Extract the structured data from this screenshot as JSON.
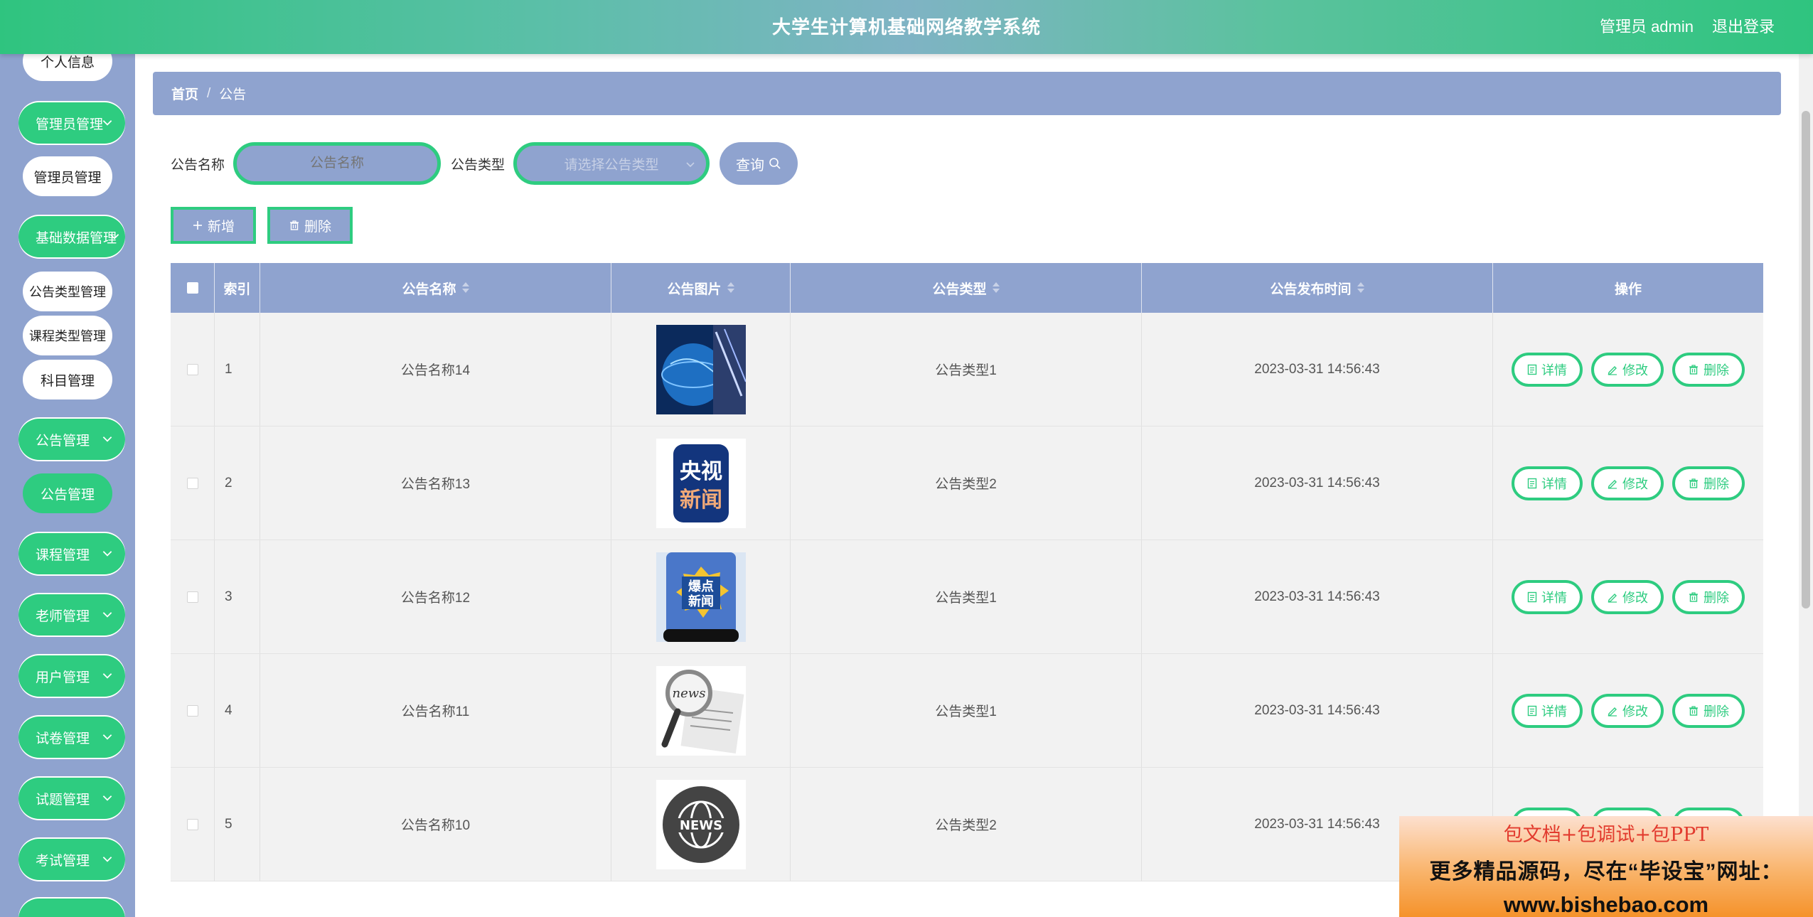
{
  "header": {
    "title": "大学生计算机基础网络教学系统",
    "user_label": "管理员 admin",
    "logout_label": "退出登录"
  },
  "sidebar": {
    "items": [
      {
        "label": "个人信息",
        "type": "sub"
      },
      {
        "label": "管理员管理",
        "type": "group"
      },
      {
        "label": "管理员管理",
        "type": "sub"
      },
      {
        "label": "基础数据管理",
        "type": "group"
      },
      {
        "label": "公告类型管理",
        "type": "sub"
      },
      {
        "label": "课程类型管理",
        "type": "sub"
      },
      {
        "label": "科目管理",
        "type": "sub"
      },
      {
        "label": "公告管理",
        "type": "group"
      },
      {
        "label": "公告管理",
        "type": "sub",
        "active": true
      },
      {
        "label": "课程管理",
        "type": "group"
      },
      {
        "label": "老师管理",
        "type": "group"
      },
      {
        "label": "用户管理",
        "type": "group"
      },
      {
        "label": "试卷管理",
        "type": "group"
      },
      {
        "label": "试题管理",
        "type": "group"
      },
      {
        "label": "考试管理",
        "type": "group"
      }
    ]
  },
  "breadcrumb": {
    "home": "首页",
    "separator": "/",
    "current": "公告"
  },
  "search": {
    "name_label": "公告名称",
    "name_placeholder": "公告名称",
    "type_label": "公告类型",
    "type_placeholder": "请选择公告类型",
    "query_label": "查询"
  },
  "actions": {
    "add_label": "新增",
    "delete_label": "删除"
  },
  "table": {
    "headers": {
      "index": "索引",
      "name": "公告名称",
      "image": "公告图片",
      "type": "公告类型",
      "time": "公告发布时间",
      "ops": "操作"
    },
    "rows": [
      {
        "index": "1",
        "name": "公告名称14",
        "image": "globe-news-image",
        "type": "公告类型1",
        "time": "2023-03-31 14:56:43"
      },
      {
        "index": "2",
        "name": "公告名称13",
        "image": "cctv-news-logo",
        "type": "公告类型2",
        "time": "2023-03-31 14:56:43"
      },
      {
        "index": "3",
        "name": "公告名称12",
        "image": "hot-news-phone",
        "type": "公告类型1",
        "time": "2023-03-31 14:56:43"
      },
      {
        "index": "4",
        "name": "公告名称11",
        "image": "newspaper-magnifier",
        "type": "公告类型1",
        "time": "2023-03-31 14:56:43"
      },
      {
        "index": "5",
        "name": "公告名称10",
        "image": "news-globe-badge",
        "type": "公告类型2",
        "time": "2023-03-31 14:56:43"
      }
    ],
    "op_labels": {
      "detail": "详情",
      "edit": "修改",
      "delete": "删除"
    }
  },
  "watermark": {
    "line1": "包文档+包调试+包PPT",
    "line2": "更多精品源码，尽在“毕设宝”网址：",
    "line3": "www.bishebao.com"
  },
  "colors": {
    "accent_green": "#2ecc80",
    "slate_blue": "#8fa3cf"
  }
}
